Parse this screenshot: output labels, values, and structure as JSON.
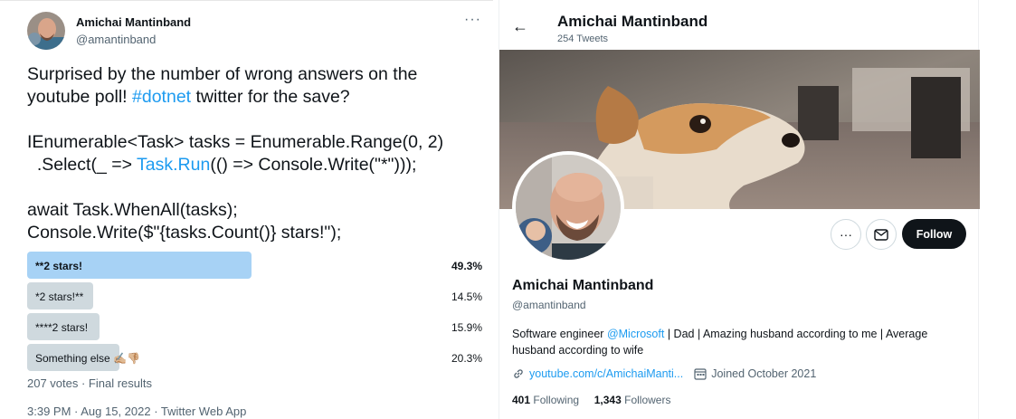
{
  "tweet": {
    "author_name": "Amichai Mantinband",
    "author_handle": "@amantinband",
    "more_icon": "more-dots-icon",
    "text_line1": "Surprised by the number of wrong answers on the",
    "text_line2_a": "youtube poll! ",
    "text_line2_link": "#dotnet",
    "text_line2_b": " twitter for the save?",
    "code_line1": "IEnumerable<Task> tasks = Enumerable.Range(0, 2)",
    "code_line2_a": "  .Select(_ => ",
    "code_line2_link": "Task.Run",
    "code_line2_b": "(() => Console.Write(\"*\")));",
    "code_line3": "await Task.WhenAll(tasks);",
    "code_line4": "Console.Write($\"{tasks.Count()} stars!\");",
    "poll": [
      {
        "label": "**2 stars!",
        "percent": "49.3%",
        "fraction": 0.493,
        "winner": true
      },
      {
        "label": "*2 stars!**",
        "percent": "14.5%",
        "fraction": 0.145,
        "winner": false
      },
      {
        "label": "****2 stars!",
        "percent": "15.9%",
        "fraction": 0.159,
        "winner": false
      },
      {
        "label": "Something else ✍🏼👎🏼",
        "percent": "20.3%",
        "fraction": 0.203,
        "winner": false
      }
    ],
    "poll_meta": "207 votes · Final results",
    "timestamp": "3:39 PM · Aug 15, 2022 · Twitter Web App"
  },
  "profile": {
    "back_icon": "back-arrow-icon",
    "header_name": "Amichai Mantinband",
    "tweet_count": "254 Tweets",
    "more_button_icon": "more-dots-icon",
    "message_button_icon": "envelope-icon",
    "follow_label": "Follow",
    "name": "Amichai Mantinband",
    "handle": "@amantinband",
    "bio_a": "Software engineer ",
    "bio_link": "@Microsoft",
    "bio_b": " | Dad | Amazing husband according to me | Average husband according to wife",
    "website": "youtube.com/c/AmichaiManti...",
    "joined": "Joined October 2021",
    "following_count": "401",
    "following_label": "Following",
    "followers_count": "1,343",
    "followers_label": "Followers",
    "accent_color": "#1d9bf0"
  }
}
